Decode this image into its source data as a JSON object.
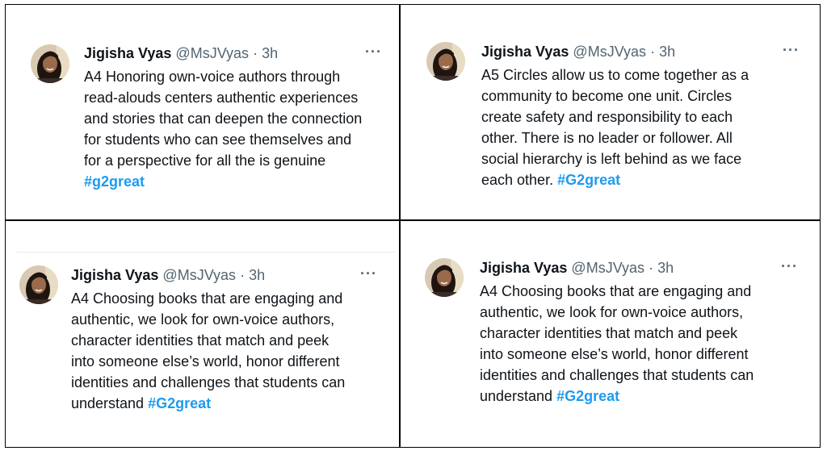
{
  "tweets": [
    {
      "author": "Jigisha Vyas",
      "handle": "@MsJVyas",
      "separator": "·",
      "time": "3h",
      "more": "···",
      "lines": [
        "A4 Honoring own-voice authors through",
        "read-alouds centers authentic experiences",
        "and stories that can deepen the connection",
        "for students who can see themselves and",
        "for a perspective for all the is genuine"
      ],
      "last_text": "",
      "hashtag": "#g2great"
    },
    {
      "author": "Jigisha Vyas",
      "handle": "@MsJVyas",
      "separator": "·",
      "time": "3h",
      "more": "···",
      "lines": [
        "A5 Circles allow us to come together as a",
        "community to become one unit. Circles",
        "create safety and responsibility to each",
        "other. There is no leader or follower. All",
        "social hierarchy is left behind as we face"
      ],
      "last_text": "each other. ",
      "hashtag": "#G2great"
    },
    {
      "author": "Jigisha Vyas",
      "handle": "@MsJVyas",
      "separator": "·",
      "time": "3h",
      "more": "···",
      "lines": [
        "A4 Choosing books that are engaging and",
        "authentic, we look for own-voice authors,",
        "character identities that match and peek",
        "into someone else’s world, honor different",
        "identities and challenges that students can"
      ],
      "last_text": "understand ",
      "hashtag": "#G2great"
    },
    {
      "author": "Jigisha Vyas",
      "handle": "@MsJVyas",
      "separator": "·",
      "time": "3h",
      "more": "···",
      "lines": [
        "A4 Choosing books that are engaging and",
        "authentic, we look for own-voice authors,",
        "character identities that match and peek",
        "into someone else’s world, honor different",
        "identities and challenges that students can"
      ],
      "last_text": "understand ",
      "hashtag": "#G2great"
    }
  ]
}
